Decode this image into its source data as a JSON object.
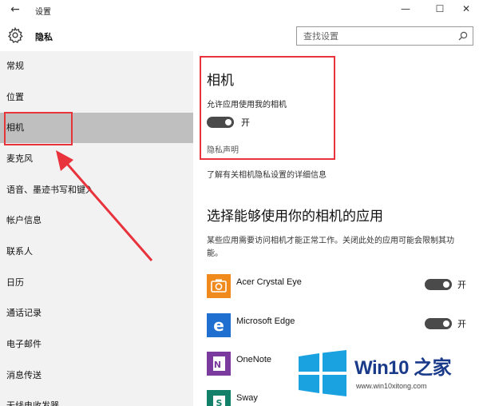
{
  "window": {
    "title": "设置",
    "back_glyph": "←",
    "minimize_glyph": "—",
    "maximize_glyph": "☐",
    "close_glyph": "✕"
  },
  "header": {
    "page_title": "隐私",
    "search_placeholder": "查找设置"
  },
  "sidebar": {
    "items": [
      {
        "label": "常规"
      },
      {
        "label": "位置"
      },
      {
        "label": "相机",
        "active": true
      },
      {
        "label": "麦克风"
      },
      {
        "label": "语音、墨迹书写和键入"
      },
      {
        "label": "帐户信息"
      },
      {
        "label": "联系人"
      },
      {
        "label": "日历"
      },
      {
        "label": "通话记录"
      },
      {
        "label": "电子邮件"
      },
      {
        "label": "消息传送"
      },
      {
        "label": "无线电收发器"
      }
    ]
  },
  "camera": {
    "title": "相机",
    "allow_label": "允许应用使用我的相机",
    "toggle_state": "开",
    "privacy_link": "隐私声明",
    "learn_more": "了解有关相机隐私设置的详细信息"
  },
  "apps_section": {
    "title": "选择能够使用你的相机的应用",
    "description": "某些应用需要访问相机才能正常工作。关闭此处的应用可能会限制其功能。",
    "apps": [
      {
        "name": "Acer Crystal Eye",
        "toggle": "开",
        "icon": "camera-app-icon",
        "color": "#f08a1c"
      },
      {
        "name": "Microsoft Edge",
        "toggle": "开",
        "icon": "edge-icon",
        "color": "#1e6fd0"
      },
      {
        "name": "OneNote",
        "toggle": "",
        "icon": "onenote-icon",
        "color": "#7a3a9e"
      },
      {
        "name": "Sway",
        "toggle": "",
        "icon": "sway-icon",
        "color": "#13816a"
      }
    ]
  },
  "watermark": {
    "brand": "Win10 之家",
    "url": "www.win10xitong.com"
  },
  "colors": {
    "sidebar_bg": "#f2f2f2",
    "active_item_bg": "#bfbfbf",
    "highlight": "#e8323c",
    "toggle_on": "#4a4a4a",
    "win_blue": "#1aa1e0"
  }
}
